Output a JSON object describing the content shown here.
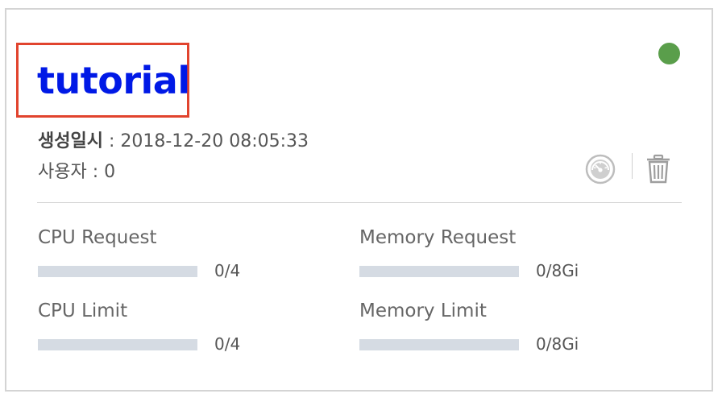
{
  "card": {
    "title": "tutorial",
    "status_color": "#5a9e4b",
    "created_label": "생성일시",
    "created_sep": " : ",
    "created_value": "2018-12-20 08:05:33",
    "users_text": "사용자 : 0",
    "icons": {
      "gauge": "gauge-icon",
      "trash": "trash-icon"
    },
    "highlight_color": "#e1442e",
    "title_color": "#0019e6"
  },
  "metrics": [
    {
      "label": "CPU Request",
      "value": "0/4",
      "fill_fraction": 0
    },
    {
      "label": "Memory Request",
      "value": "0/8Gi",
      "fill_fraction": 0
    },
    {
      "label": "CPU Limit",
      "value": "0/4",
      "fill_fraction": 0
    },
    {
      "label": "Memory Limit",
      "value": "0/8Gi",
      "fill_fraction": 0
    }
  ]
}
